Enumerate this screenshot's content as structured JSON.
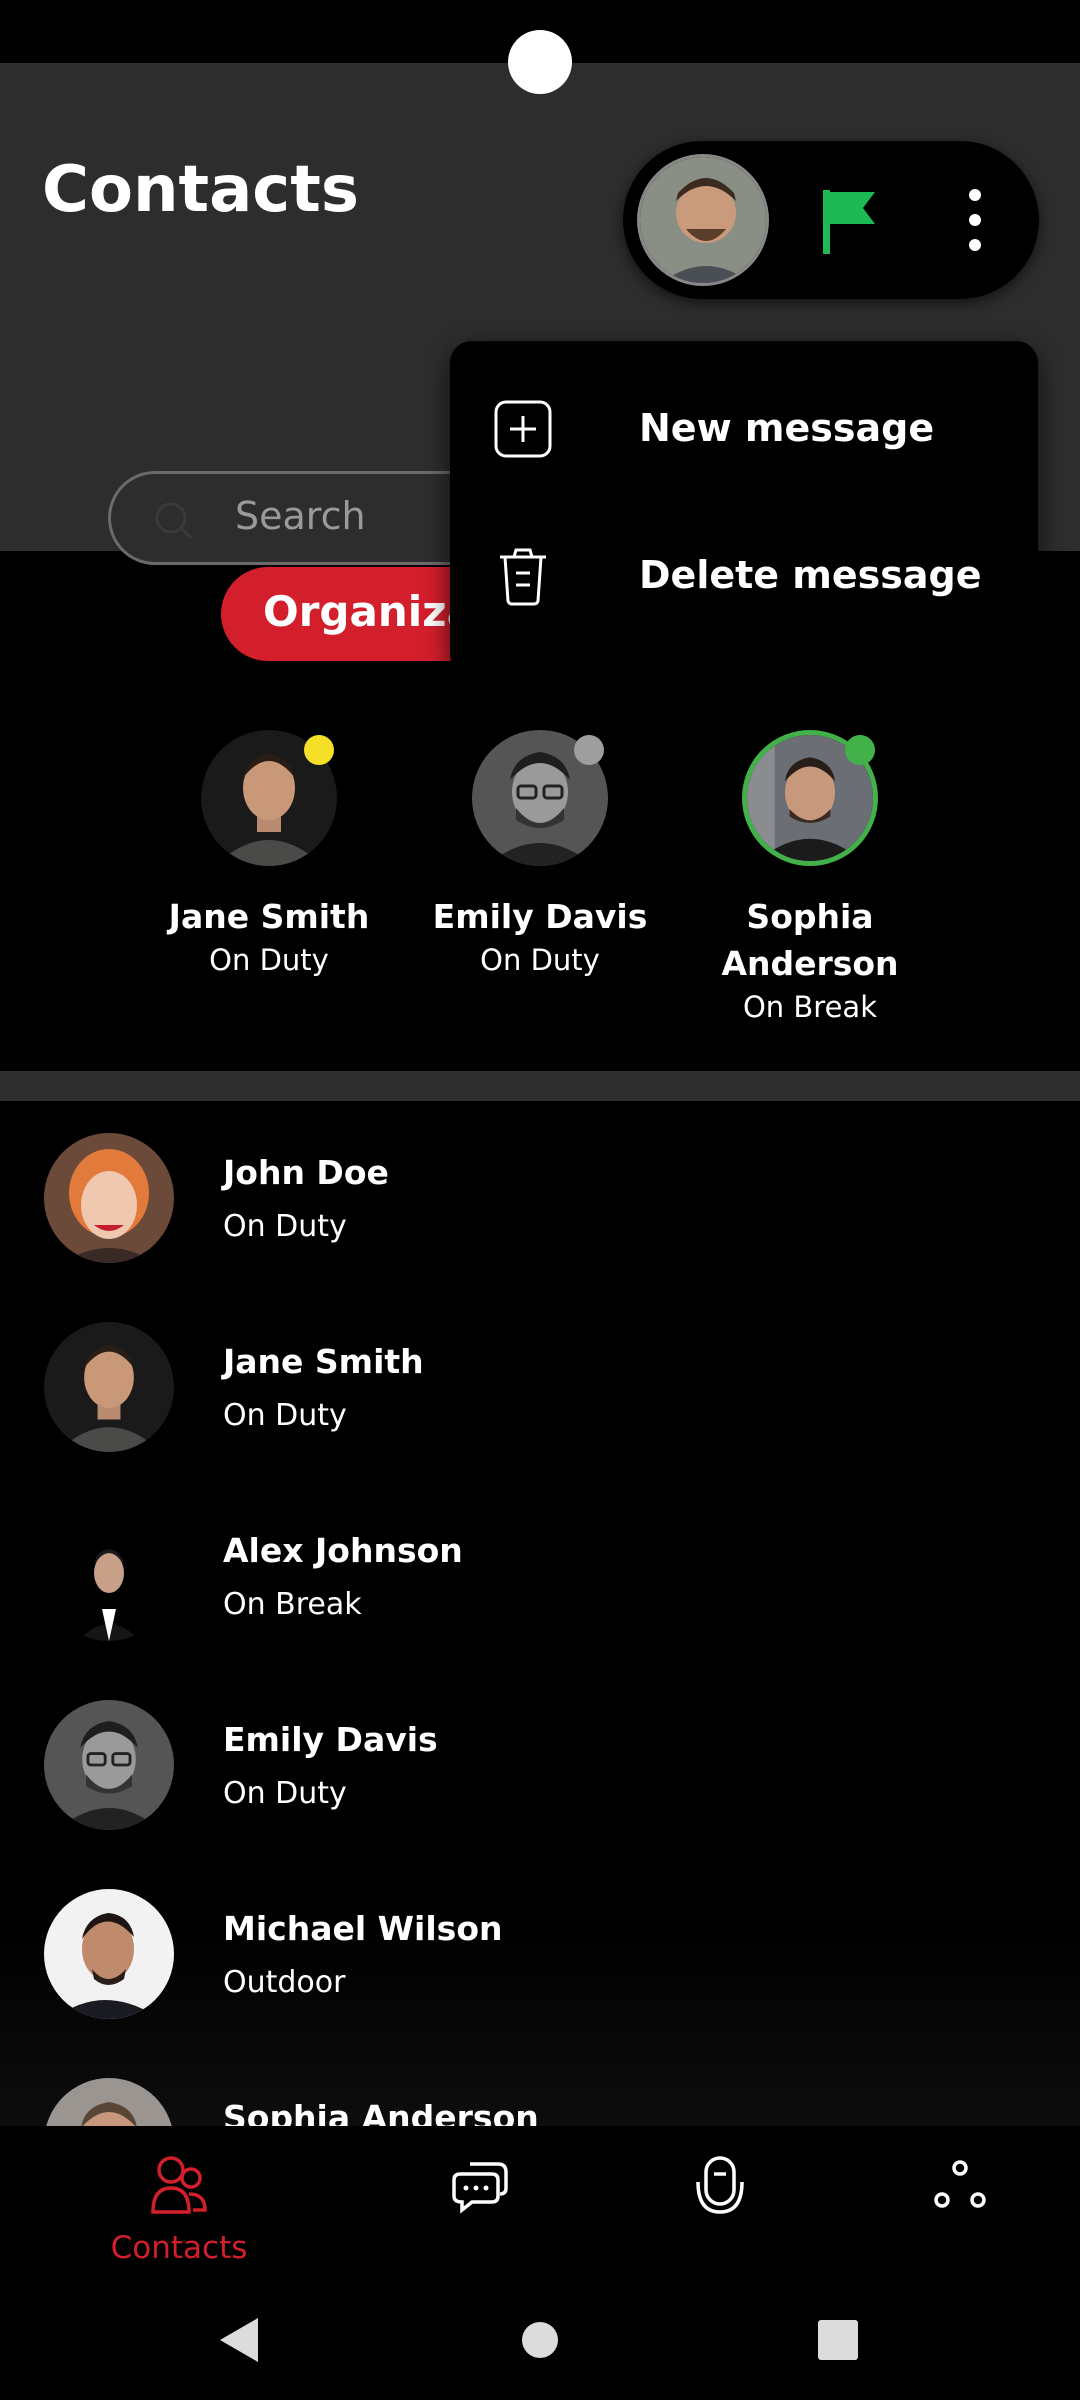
{
  "header": {
    "title": "Contacts",
    "search_placeholder": "Search",
    "org_button_label": "Organization"
  },
  "profile_pill": {
    "avatar_icon": "user-avatar",
    "flag_icon": "flag-icon",
    "flag_color": "#1db954",
    "menu_icon": "kebab-icon"
  },
  "popup_menu": {
    "items": [
      {
        "label": "New message",
        "icon": "plus-square-icon"
      },
      {
        "label": "Delete message",
        "icon": "trash-icon"
      }
    ]
  },
  "featured": [
    {
      "name": "Jane Smith",
      "status": "On Duty",
      "presence_color": "#f5e027"
    },
    {
      "name": "Emily Davis",
      "status": "On Duty",
      "presence_color": "#9e9e9e"
    },
    {
      "name": "Sophia Anderson",
      "name_line1": "Sophia",
      "name_line2": "Anderson",
      "status": "On Break",
      "presence_color": "#43b14a"
    }
  ],
  "contacts": [
    {
      "name": "John Doe",
      "status": "On Duty"
    },
    {
      "name": "Jane Smith",
      "status": "On Duty"
    },
    {
      "name": "Alex Johnson",
      "status": "On Break"
    },
    {
      "name": "Emily Davis",
      "status": "On Duty"
    },
    {
      "name": "Michael Wilson",
      "status": "Outdoor"
    },
    {
      "name": "Sophia Anderson",
      "status": ""
    }
  ],
  "bottom_nav": {
    "active_color": "#d21f2b",
    "items": [
      {
        "label": "Contacts",
        "icon": "contacts-icon",
        "active": true
      },
      {
        "label": "",
        "icon": "chat-icon",
        "active": false
      },
      {
        "label": "",
        "icon": "walkie-talkie-icon",
        "active": false
      },
      {
        "label": "",
        "icon": "share-nodes-icon",
        "active": false
      }
    ]
  }
}
